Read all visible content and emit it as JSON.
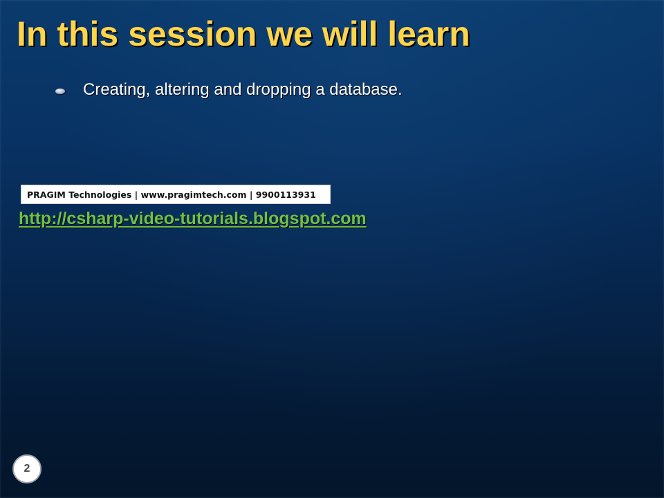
{
  "slide": {
    "title": "In this session we will learn",
    "bullets": [
      {
        "text": "Creating, altering and dropping a database."
      }
    ],
    "banner": {
      "text": "PRAGIM Technologies | www.pragimtech.com | 9900113931"
    },
    "link": {
      "text": "http://csharp-video-tutorials.blogspot.com"
    },
    "page_number": "2"
  },
  "colors": {
    "title": "#ffd44a",
    "link": "#6fc144",
    "background_top": "#0a3a6c",
    "background_bottom": "#03152b"
  },
  "icons": {
    "bullet": "oval-bullet-icon"
  }
}
